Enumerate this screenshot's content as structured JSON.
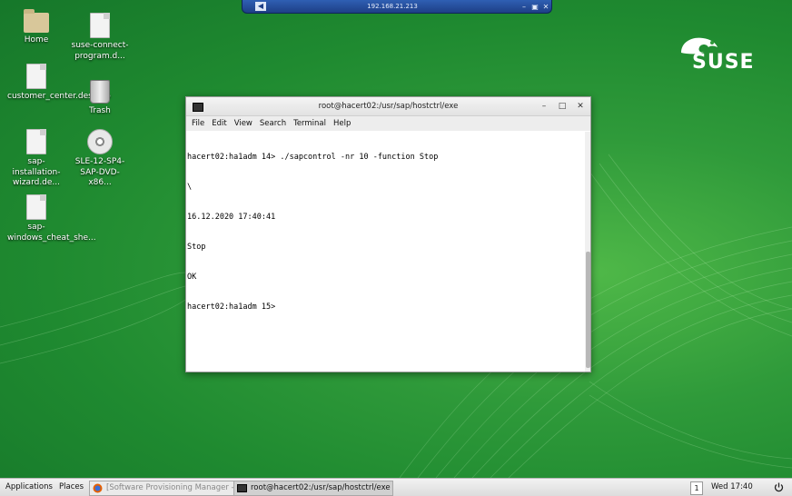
{
  "remote": {
    "host": "192.168.21.213"
  },
  "desktop_icons": [
    {
      "label": "Home"
    },
    {
      "label": "suse-connect-program.d..."
    },
    {
      "label": "customer_center.desktop"
    },
    {
      "label": "Trash"
    },
    {
      "label": "sap-installation-wizard.de..."
    },
    {
      "label": "SLE-12-SP4-SAP-DVD-x86..."
    },
    {
      "label": "sap-windows_cheat_she..."
    }
  ],
  "brand": {
    "name": "SUSE"
  },
  "terminal": {
    "title": "root@hacert02:/usr/sap/hostctrl/exe",
    "menu": [
      "File",
      "Edit",
      "View",
      "Search",
      "Terminal",
      "Help"
    ],
    "lines": [
      "hacert02:ha1adm 14> ./sapcontrol -nr 10 -function Stop",
      "\\",
      "16.12.2020 17:40:41",
      "Stop",
      "OK",
      "hacert02:ha1adm 15>"
    ]
  },
  "taskbar": {
    "applications": "Applications",
    "places": "Places",
    "tasks": [
      {
        "label": "[Software Provisioning Manager - ..."
      },
      {
        "label": "root@hacert02:/usr/sap/hostctrl/exe"
      }
    ],
    "workspace": "1",
    "clock": "Wed 17:40"
  },
  "colors": {
    "desktop": "#2f9a3a",
    "accent": "#30ba78"
  }
}
